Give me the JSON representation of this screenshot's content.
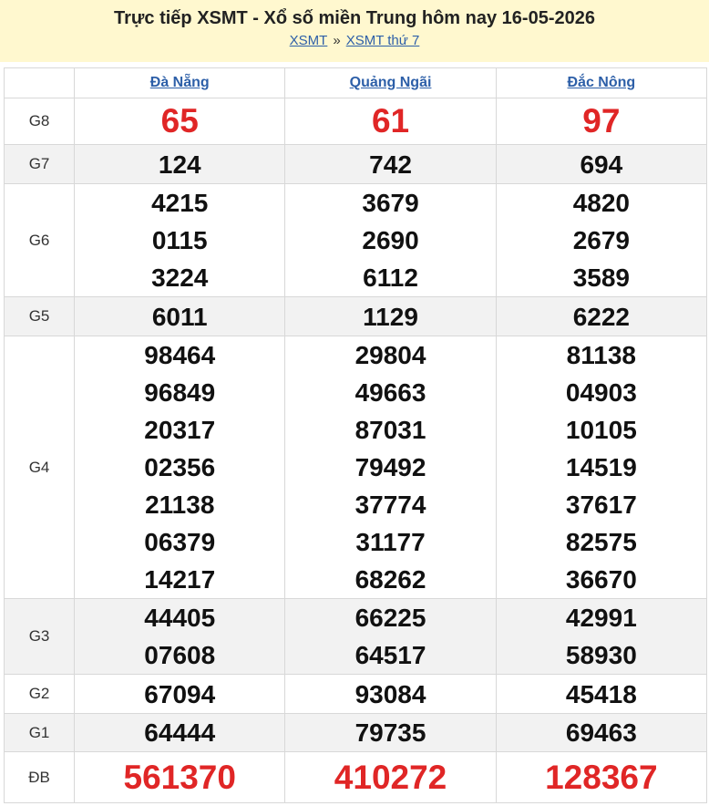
{
  "header": {
    "title": "Trực tiếp XSMT - Xổ số miền Trung hôm nay 16-05-2026",
    "crumb_home": "XSMT",
    "crumb_sep": "»",
    "crumb_current": "XSMT thứ 7"
  },
  "provinces": [
    "Đà Nẵng",
    "Quảng Ngãi",
    "Đắc Nông"
  ],
  "prizes": [
    {
      "label": "G8",
      "numbers": [
        [
          "65"
        ],
        [
          "61"
        ],
        [
          "97"
        ]
      ]
    },
    {
      "label": "G7",
      "numbers": [
        [
          "124"
        ],
        [
          "742"
        ],
        [
          "694"
        ]
      ]
    },
    {
      "label": "G6",
      "numbers": [
        [
          "4215",
          "0115",
          "3224"
        ],
        [
          "3679",
          "2690",
          "6112"
        ],
        [
          "4820",
          "2679",
          "3589"
        ]
      ]
    },
    {
      "label": "G5",
      "numbers": [
        [
          "6011"
        ],
        [
          "1129"
        ],
        [
          "6222"
        ]
      ]
    },
    {
      "label": "G4",
      "numbers": [
        [
          "98464",
          "96849",
          "20317",
          "02356",
          "21138",
          "06379",
          "14217"
        ],
        [
          "29804",
          "49663",
          "87031",
          "79492",
          "37774",
          "31177",
          "68262"
        ],
        [
          "81138",
          "04903",
          "10105",
          "14519",
          "37617",
          "82575",
          "36670"
        ]
      ]
    },
    {
      "label": "G3",
      "numbers": [
        [
          "44405",
          "07608"
        ],
        [
          "66225",
          "64517"
        ],
        [
          "42991",
          "58930"
        ]
      ]
    },
    {
      "label": "G2",
      "numbers": [
        [
          "67094"
        ],
        [
          "93084"
        ],
        [
          "45418"
        ]
      ]
    },
    {
      "label": "G1",
      "numbers": [
        [
          "64444"
        ],
        [
          "79735"
        ],
        [
          "69463"
        ]
      ]
    },
    {
      "label": "ĐB",
      "numbers": [
        [
          "561370"
        ],
        [
          "410272"
        ],
        [
          "128367"
        ]
      ]
    }
  ],
  "colors": {
    "header_bg": "#fff8cf",
    "link": "#2d5fa8",
    "highlight_red": "#e02626",
    "alt_row": "#f2f2f2"
  }
}
